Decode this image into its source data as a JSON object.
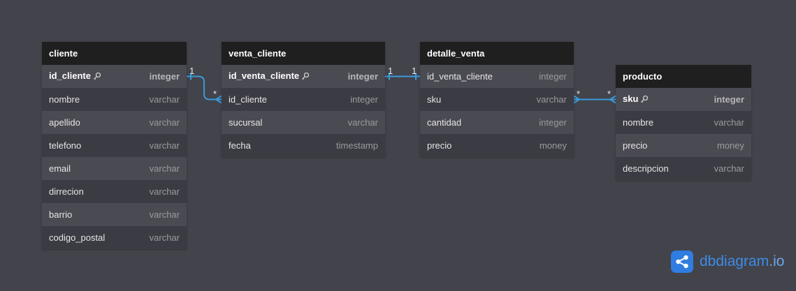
{
  "tables": [
    {
      "name": "cliente",
      "fields": [
        {
          "name": "id_cliente",
          "type": "integer",
          "pk": true
        },
        {
          "name": "nombre",
          "type": "varchar"
        },
        {
          "name": "apellido",
          "type": "varchar"
        },
        {
          "name": "telefono",
          "type": "varchar"
        },
        {
          "name": "email",
          "type": "varchar"
        },
        {
          "name": "dirrecion",
          "type": "varchar"
        },
        {
          "name": "barrio",
          "type": "varchar"
        },
        {
          "name": "codigo_postal",
          "type": "varchar"
        }
      ]
    },
    {
      "name": "venta_cliente",
      "fields": [
        {
          "name": "id_venta_cliente",
          "type": "integer",
          "pk": true
        },
        {
          "name": "id_cliente",
          "type": "integer"
        },
        {
          "name": "sucursal",
          "type": "varchar"
        },
        {
          "name": "fecha",
          "type": "timestamp"
        }
      ]
    },
    {
      "name": "detalle_venta",
      "fields": [
        {
          "name": "id_venta_cliente",
          "type": "integer"
        },
        {
          "name": "sku",
          "type": "varchar"
        },
        {
          "name": "cantidad",
          "type": "integer"
        },
        {
          "name": "precio",
          "type": "money"
        }
      ]
    },
    {
      "name": "producto",
      "fields": [
        {
          "name": "sku",
          "type": "integer",
          "pk": true
        },
        {
          "name": "nombre",
          "type": "varchar"
        },
        {
          "name": "precio",
          "type": "money"
        },
        {
          "name": "descripcion",
          "type": "varchar"
        }
      ]
    }
  ],
  "relations": [
    {
      "from": "cliente.id_cliente",
      "from_card": "1",
      "to": "venta_cliente.id_cliente",
      "to_card": "*"
    },
    {
      "from": "venta_cliente.id_venta_cliente",
      "from_card": "1",
      "to": "detalle_venta.id_venta_cliente",
      "to_card": "1"
    },
    {
      "from": "detalle_venta.sku",
      "from_card": "*",
      "to": "producto.sku",
      "to_card": "*"
    }
  ],
  "colors": {
    "background": "#43434b",
    "header": "#1f1f20",
    "relation_line": "#3a9ad9",
    "brand": "#2f7de0"
  },
  "brand": {
    "name": "dbdiagram",
    "tld": ".io",
    "icon": "share-icon"
  }
}
